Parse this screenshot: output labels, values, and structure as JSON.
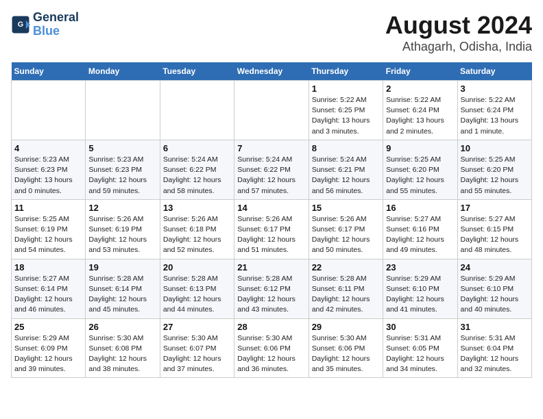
{
  "header": {
    "logo_line1": "General",
    "logo_line2": "Blue",
    "title": "August 2024",
    "subtitle": "Athagarh, Odisha, India"
  },
  "weekdays": [
    "Sunday",
    "Monday",
    "Tuesday",
    "Wednesday",
    "Thursday",
    "Friday",
    "Saturday"
  ],
  "weeks": [
    [
      {
        "day": "",
        "info": ""
      },
      {
        "day": "",
        "info": ""
      },
      {
        "day": "",
        "info": ""
      },
      {
        "day": "",
        "info": ""
      },
      {
        "day": "1",
        "info": "Sunrise: 5:22 AM\nSunset: 6:25 PM\nDaylight: 13 hours\nand 3 minutes."
      },
      {
        "day": "2",
        "info": "Sunrise: 5:22 AM\nSunset: 6:24 PM\nDaylight: 13 hours\nand 2 minutes."
      },
      {
        "day": "3",
        "info": "Sunrise: 5:22 AM\nSunset: 6:24 PM\nDaylight: 13 hours\nand 1 minute."
      }
    ],
    [
      {
        "day": "4",
        "info": "Sunrise: 5:23 AM\nSunset: 6:23 PM\nDaylight: 13 hours\nand 0 minutes."
      },
      {
        "day": "5",
        "info": "Sunrise: 5:23 AM\nSunset: 6:23 PM\nDaylight: 12 hours\nand 59 minutes."
      },
      {
        "day": "6",
        "info": "Sunrise: 5:24 AM\nSunset: 6:22 PM\nDaylight: 12 hours\nand 58 minutes."
      },
      {
        "day": "7",
        "info": "Sunrise: 5:24 AM\nSunset: 6:22 PM\nDaylight: 12 hours\nand 57 minutes."
      },
      {
        "day": "8",
        "info": "Sunrise: 5:24 AM\nSunset: 6:21 PM\nDaylight: 12 hours\nand 56 minutes."
      },
      {
        "day": "9",
        "info": "Sunrise: 5:25 AM\nSunset: 6:20 PM\nDaylight: 12 hours\nand 55 minutes."
      },
      {
        "day": "10",
        "info": "Sunrise: 5:25 AM\nSunset: 6:20 PM\nDaylight: 12 hours\nand 55 minutes."
      }
    ],
    [
      {
        "day": "11",
        "info": "Sunrise: 5:25 AM\nSunset: 6:19 PM\nDaylight: 12 hours\nand 54 minutes."
      },
      {
        "day": "12",
        "info": "Sunrise: 5:26 AM\nSunset: 6:19 PM\nDaylight: 12 hours\nand 53 minutes."
      },
      {
        "day": "13",
        "info": "Sunrise: 5:26 AM\nSunset: 6:18 PM\nDaylight: 12 hours\nand 52 minutes."
      },
      {
        "day": "14",
        "info": "Sunrise: 5:26 AM\nSunset: 6:17 PM\nDaylight: 12 hours\nand 51 minutes."
      },
      {
        "day": "15",
        "info": "Sunrise: 5:26 AM\nSunset: 6:17 PM\nDaylight: 12 hours\nand 50 minutes."
      },
      {
        "day": "16",
        "info": "Sunrise: 5:27 AM\nSunset: 6:16 PM\nDaylight: 12 hours\nand 49 minutes."
      },
      {
        "day": "17",
        "info": "Sunrise: 5:27 AM\nSunset: 6:15 PM\nDaylight: 12 hours\nand 48 minutes."
      }
    ],
    [
      {
        "day": "18",
        "info": "Sunrise: 5:27 AM\nSunset: 6:14 PM\nDaylight: 12 hours\nand 46 minutes."
      },
      {
        "day": "19",
        "info": "Sunrise: 5:28 AM\nSunset: 6:14 PM\nDaylight: 12 hours\nand 45 minutes."
      },
      {
        "day": "20",
        "info": "Sunrise: 5:28 AM\nSunset: 6:13 PM\nDaylight: 12 hours\nand 44 minutes."
      },
      {
        "day": "21",
        "info": "Sunrise: 5:28 AM\nSunset: 6:12 PM\nDaylight: 12 hours\nand 43 minutes."
      },
      {
        "day": "22",
        "info": "Sunrise: 5:28 AM\nSunset: 6:11 PM\nDaylight: 12 hours\nand 42 minutes."
      },
      {
        "day": "23",
        "info": "Sunrise: 5:29 AM\nSunset: 6:10 PM\nDaylight: 12 hours\nand 41 minutes."
      },
      {
        "day": "24",
        "info": "Sunrise: 5:29 AM\nSunset: 6:10 PM\nDaylight: 12 hours\nand 40 minutes."
      }
    ],
    [
      {
        "day": "25",
        "info": "Sunrise: 5:29 AM\nSunset: 6:09 PM\nDaylight: 12 hours\nand 39 minutes."
      },
      {
        "day": "26",
        "info": "Sunrise: 5:30 AM\nSunset: 6:08 PM\nDaylight: 12 hours\nand 38 minutes."
      },
      {
        "day": "27",
        "info": "Sunrise: 5:30 AM\nSunset: 6:07 PM\nDaylight: 12 hours\nand 37 minutes."
      },
      {
        "day": "28",
        "info": "Sunrise: 5:30 AM\nSunset: 6:06 PM\nDaylight: 12 hours\nand 36 minutes."
      },
      {
        "day": "29",
        "info": "Sunrise: 5:30 AM\nSunset: 6:06 PM\nDaylight: 12 hours\nand 35 minutes."
      },
      {
        "day": "30",
        "info": "Sunrise: 5:31 AM\nSunset: 6:05 PM\nDaylight: 12 hours\nand 34 minutes."
      },
      {
        "day": "31",
        "info": "Sunrise: 5:31 AM\nSunset: 6:04 PM\nDaylight: 12 hours\nand 32 minutes."
      }
    ]
  ]
}
